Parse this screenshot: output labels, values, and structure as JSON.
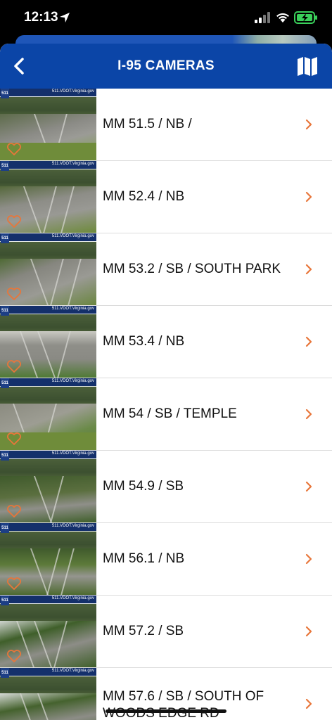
{
  "status_bar": {
    "time": "12:13",
    "icons": [
      "location-arrow-icon",
      "cellular-signal-icon",
      "wifi-icon",
      "battery-charging-icon"
    ],
    "battery_color": "#3ad05a"
  },
  "header": {
    "title": "I-95 CAMERAS",
    "back_icon": "chevron-left-icon",
    "map_icon": "map-icon",
    "background": "#0b45a7"
  },
  "cameras": [
    {
      "label": "MM 51.5 / NB /",
      "watermark": "511.VDOT.Virginia.gov",
      "logo": "511"
    },
    {
      "label": "MM 52.4 / NB",
      "watermark": "511.VDOT.Virginia.gov",
      "logo": "511"
    },
    {
      "label": "MM 53.2 / SB / SOUTH PARK",
      "watermark": "511.VDOT.Virginia.gov",
      "logo": "511"
    },
    {
      "label": "MM 53.4 / NB",
      "watermark": "511.VDOT.Virginia.gov",
      "logo": "511"
    },
    {
      "label": "MM 54 / SB / TEMPLE",
      "watermark": "511.VDOT.Virginia.gov",
      "logo": "511"
    },
    {
      "label": "MM 54.9 / SB",
      "watermark": "511.VDOT.Virginia.gov",
      "logo": "511"
    },
    {
      "label": "MM 56.1 / NB",
      "watermark": "511.VDOT.Virginia.gov",
      "logo": "511"
    },
    {
      "label": "MM 57.2 / SB",
      "watermark": "511.VDOT.Virginia.gov",
      "logo": "511"
    },
    {
      "label": "MM 57.6 / SB / SOUTH OF WOODS EDGE RD",
      "watermark": "511.VDOT.Virginia.gov",
      "logo": "511"
    }
  ],
  "accent_color": "#e8763a"
}
